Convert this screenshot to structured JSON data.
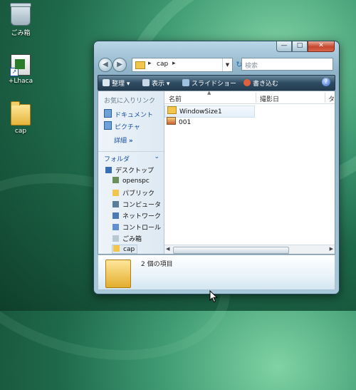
{
  "desktop": {
    "icons": [
      {
        "label": "ごみ箱"
      },
      {
        "label": "+Lhaca"
      },
      {
        "label": "cap"
      }
    ]
  },
  "window": {
    "controls": {
      "minimize": "—",
      "maximize": "□",
      "close": "✕"
    },
    "address": {
      "current_folder": "cap"
    },
    "search_placeholder": "検索",
    "toolbar": {
      "organize": "整理",
      "views": "表示",
      "slideshow": "スライドショー",
      "burn": "書き込む",
      "help": "?"
    },
    "nav_pane": {
      "favorites_title": "お気に入りリンク",
      "favorites": [
        "ドキュメント",
        "ピクチャ"
      ],
      "more": "詳細",
      "folders_title": "フォルダ",
      "tree": [
        "デスクトップ",
        "openspc",
        "パブリック",
        "コンピュータ",
        "ネットワーク",
        "コントロール",
        "ごみ箱",
        "cap"
      ]
    },
    "columns": [
      "名前",
      "撮影日",
      "タ"
    ],
    "files": [
      {
        "name": "WindowSize1",
        "type": "folder"
      },
      {
        "name": "001",
        "type": "image"
      }
    ],
    "details": {
      "item_count_text": "2 個の項目"
    }
  },
  "colors": {
    "accent": "#1a4fa0",
    "toolbar_dark": "#2f4c62",
    "folder": "#f2c64c",
    "desktop": "#2a7a56"
  }
}
